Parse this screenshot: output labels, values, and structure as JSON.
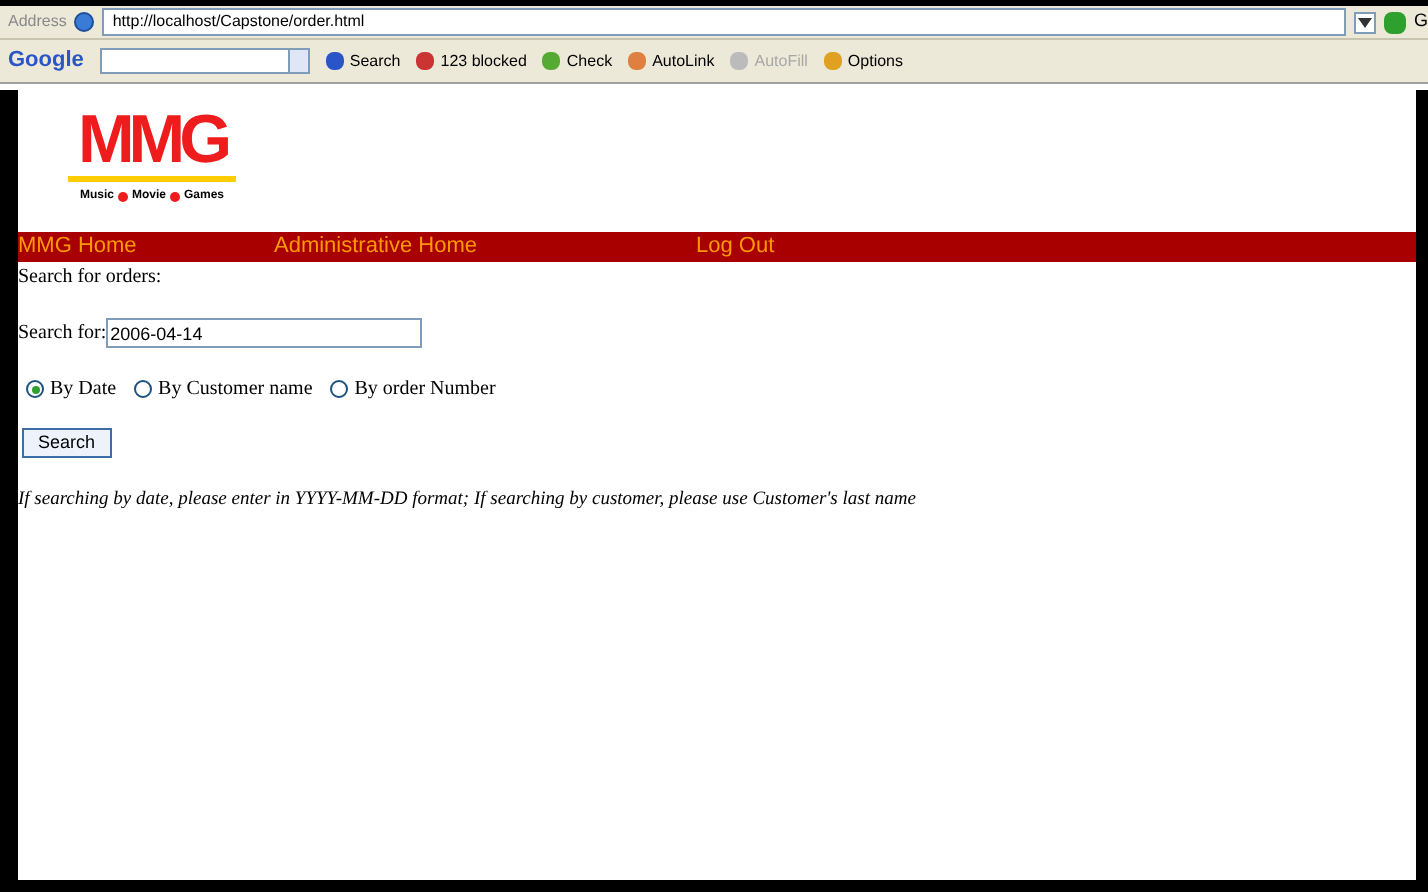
{
  "address_bar": {
    "label": "Address",
    "url": "http://localhost/Capstone/order.html",
    "go": "G"
  },
  "toolbar": {
    "brand": "Google",
    "items": [
      {
        "kind": "search",
        "label": "Search",
        "disabled": false
      },
      {
        "kind": "blocked",
        "label": "123 blocked",
        "disabled": false
      },
      {
        "kind": "check",
        "label": "Check",
        "disabled": false
      },
      {
        "kind": "autolink",
        "label": "AutoLink",
        "disabled": false
      },
      {
        "kind": "autofill",
        "label": "AutoFill",
        "disabled": true
      },
      {
        "kind": "options",
        "label": "Options",
        "disabled": false
      }
    ]
  },
  "logo": {
    "mark": "MMG",
    "tagline": [
      "Music",
      "Movie",
      "Games"
    ]
  },
  "nav": [
    "MMG Home",
    "Administrative Home",
    "Log Out"
  ],
  "heading": "Search for orders:",
  "search": {
    "label": "Search for:",
    "value": "2006-04-14"
  },
  "radios": [
    {
      "label": "By Date",
      "selected": true
    },
    {
      "label": "By Customer name",
      "selected": false
    },
    {
      "label": "By order Number",
      "selected": false
    }
  ],
  "button": "Search",
  "hint": "If searching by date, please enter in YYYY-MM-DD format; If searching by customer, please use Customer's last name"
}
